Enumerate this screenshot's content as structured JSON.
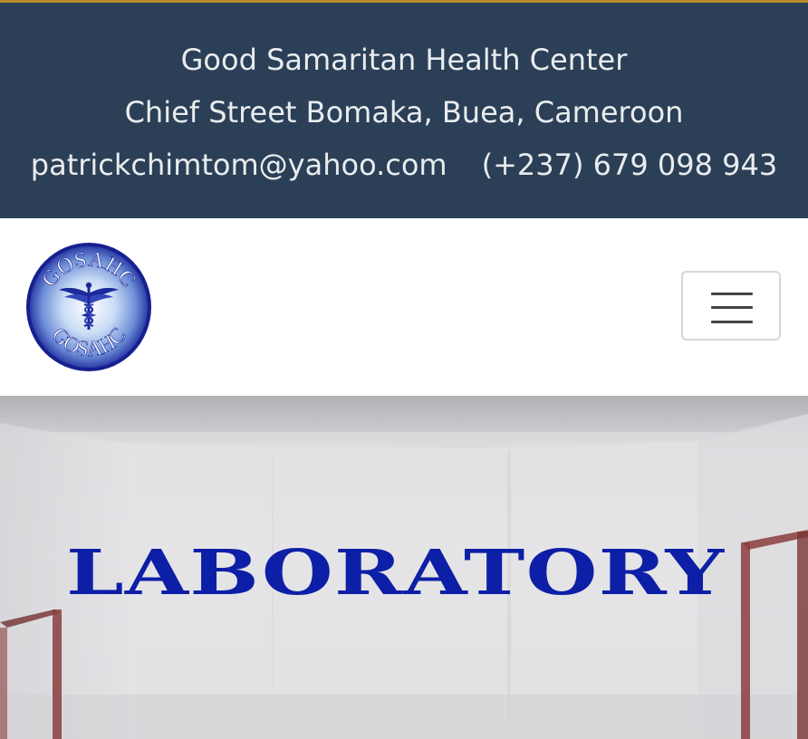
{
  "topbar": {
    "org_name": "Good Samaritan Health Center",
    "address": "Chief Street Bomaka, Buea, Cameroon",
    "email": "patrickchimtom@yahoo.com",
    "phone": "(+237) 679 098 943"
  },
  "header": {
    "logo": {
      "text_top": "GOSAHC",
      "text_bottom": "GOSAHC",
      "icon": "caduceus-icon"
    },
    "menu_toggle_icon": "hamburger-menu-icon"
  },
  "hero": {
    "title": "LABORATORY"
  },
  "colors": {
    "topbar_bg": "#2b3f56",
    "topbar_accent": "#b98a2a",
    "hero_title": "#0d1fa6"
  }
}
